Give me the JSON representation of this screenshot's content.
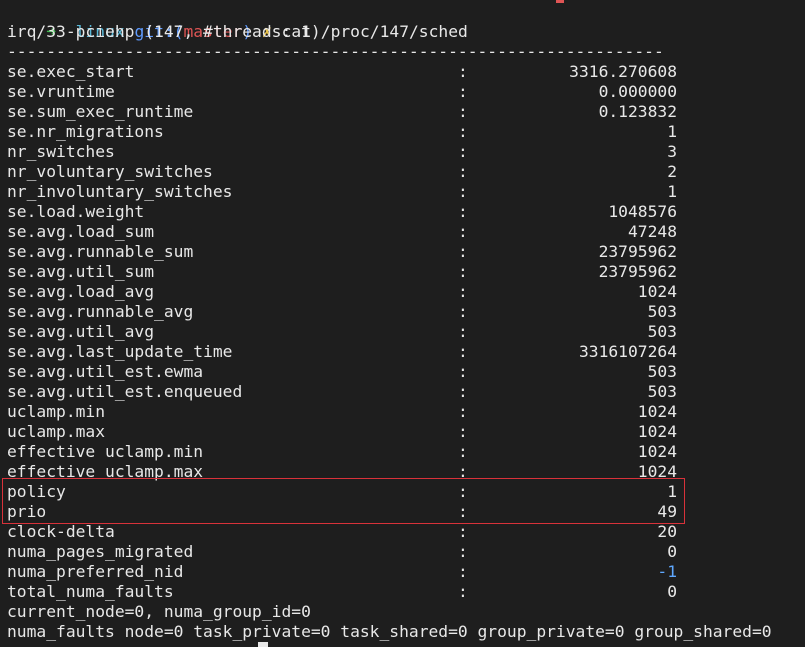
{
  "prompt": {
    "arrow": "➜",
    "dir": "linux",
    "git_label": "git:(",
    "branch": "master",
    "git_close": ")",
    "dirty": "✗",
    "command": "cat /proc/147/sched"
  },
  "header": "irq/33-pciehp (147, #threads: 1)",
  "separator": "-------------------------------------------------------------------",
  "colon": ":",
  "rows": [
    {
      "key": "se.exec_start",
      "value": "3316.270608"
    },
    {
      "key": "se.vruntime",
      "value": "0.000000"
    },
    {
      "key": "se.sum_exec_runtime",
      "value": "0.123832"
    },
    {
      "key": "se.nr_migrations",
      "value": "1"
    },
    {
      "key": "nr_switches",
      "value": "3"
    },
    {
      "key": "nr_voluntary_switches",
      "value": "2"
    },
    {
      "key": "nr_involuntary_switches",
      "value": "1"
    },
    {
      "key": "se.load.weight",
      "value": "1048576"
    },
    {
      "key": "se.avg.load_sum",
      "value": "47248"
    },
    {
      "key": "se.avg.runnable_sum",
      "value": "23795962"
    },
    {
      "key": "se.avg.util_sum",
      "value": "23795962"
    },
    {
      "key": "se.avg.load_avg",
      "value": "1024"
    },
    {
      "key": "se.avg.runnable_avg",
      "value": "503"
    },
    {
      "key": "se.avg.util_avg",
      "value": "503"
    },
    {
      "key": "se.avg.last_update_time",
      "value": "3316107264"
    },
    {
      "key": "se.avg.util_est.ewma",
      "value": "503"
    },
    {
      "key": "se.avg.util_est.enqueued",
      "value": "503"
    },
    {
      "key": "uclamp.min",
      "value": "1024"
    },
    {
      "key": "uclamp.max",
      "value": "1024"
    },
    {
      "key": "effective uclamp.min",
      "value": "1024"
    },
    {
      "key": "effective uclamp.max",
      "value": "1024"
    },
    {
      "key": "policy",
      "value": "1"
    },
    {
      "key": "prio",
      "value": "49"
    },
    {
      "key": "clock-delta",
      "value": "20"
    },
    {
      "key": "numa_pages_migrated",
      "value": "0"
    },
    {
      "key": "numa_preferred_nid",
      "value": "-1"
    },
    {
      "key": "total_numa_faults",
      "value": "0"
    }
  ],
  "footer": [
    "current_node=0, numa_group_id=0",
    "numa_faults node=0 task_private=0 task_shared=0 group_private=0 group_shared=0"
  ],
  "colors": {
    "background": "#1e1e1e",
    "text": "#e8e8e8",
    "highlight_border": "#d9323a",
    "negative_value": "#5fa8ff"
  }
}
